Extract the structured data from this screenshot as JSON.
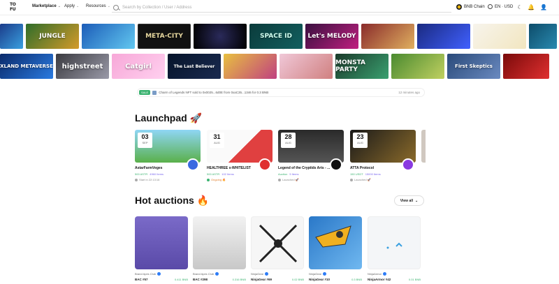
{
  "header": {
    "logo": "TOFU NFT",
    "nav": [
      {
        "label": "Marketplace"
      },
      {
        "label": "Apply"
      },
      {
        "label": "Resources"
      }
    ],
    "search_placeholder": "Search by Collection / User / Address",
    "chain_label": "BNB Chain",
    "lang_label": "EN · USD"
  },
  "banners_row1": [
    {
      "label": ""
    },
    {
      "label": "JUNGLE"
    },
    {
      "label": ""
    },
    {
      "label": "META-CITY"
    },
    {
      "label": ""
    },
    {
      "label": "SPACE ID"
    },
    {
      "label": "Let's MELODY"
    },
    {
      "label": ""
    },
    {
      "label": ""
    },
    {
      "label": ""
    },
    {
      "label": ""
    }
  ],
  "banners_row2": [
    {
      "label": "XLAND METAVERSE"
    },
    {
      "label": "highstreet"
    },
    {
      "label": "Catgirl"
    },
    {
      "label": "The Last Believer"
    },
    {
      "label": ""
    },
    {
      "label": ""
    },
    {
      "label": "MONSTA PARTY"
    },
    {
      "label": ""
    },
    {
      "label": "First Skeptics"
    },
    {
      "label": ""
    }
  ],
  "ticker": {
    "badge": "SALE",
    "text": "Charm of Legends NFT sold to 0x0025...6d0E from 0xaC35...1346 for 0.3 BNB",
    "time": "12 minutes ago"
  },
  "launchpad": {
    "title": "Launchpad 🚀",
    "cards": [
      {
        "day": "03",
        "month": "SEP",
        "name": "AstarFarmVeges",
        "price": "500 ASTR",
        "items": "4960 Items",
        "status": "Start in 22:13:16"
      },
      {
        "day": "31",
        "month": "AUG",
        "name": "HEALTHREE x-WHITELIST",
        "price": "500 ASTR",
        "items": "102 Items",
        "status": "Ongoing 🔥"
      },
      {
        "day": "28",
        "month": "AUG",
        "name": "Legend of the Cryptids Arts - ...",
        "price": "Auction",
        "items": "5 Items",
        "status": "Launched 🚀"
      },
      {
        "day": "23",
        "month": "AUG",
        "name": "ATTA Protocol",
        "price": "150 USDT",
        "items": "15000 Items",
        "status": "Launched 🚀"
      }
    ]
  },
  "auctions": {
    "title": "Hot auctions 🔥",
    "view_all": "View all",
    "cards": [
      {
        "collection": "Brand Apes Club",
        "name": "BAC #57",
        "price": "0.411 BNB"
      },
      {
        "collection": "Brand Apes Club",
        "name": "BAC #298",
        "price": "0.316 BNB"
      },
      {
        "collection": "NinjaGear",
        "name": "NinjaGear #69",
        "price": "0.02 BNB"
      },
      {
        "collection": "NinjaGear",
        "name": "NinjaGear #10",
        "price": "0.3 BNB"
      },
      {
        "collection": "NinjaArmor",
        "name": "NinjaArmor #42",
        "price": "0.01 BNB"
      }
    ]
  }
}
